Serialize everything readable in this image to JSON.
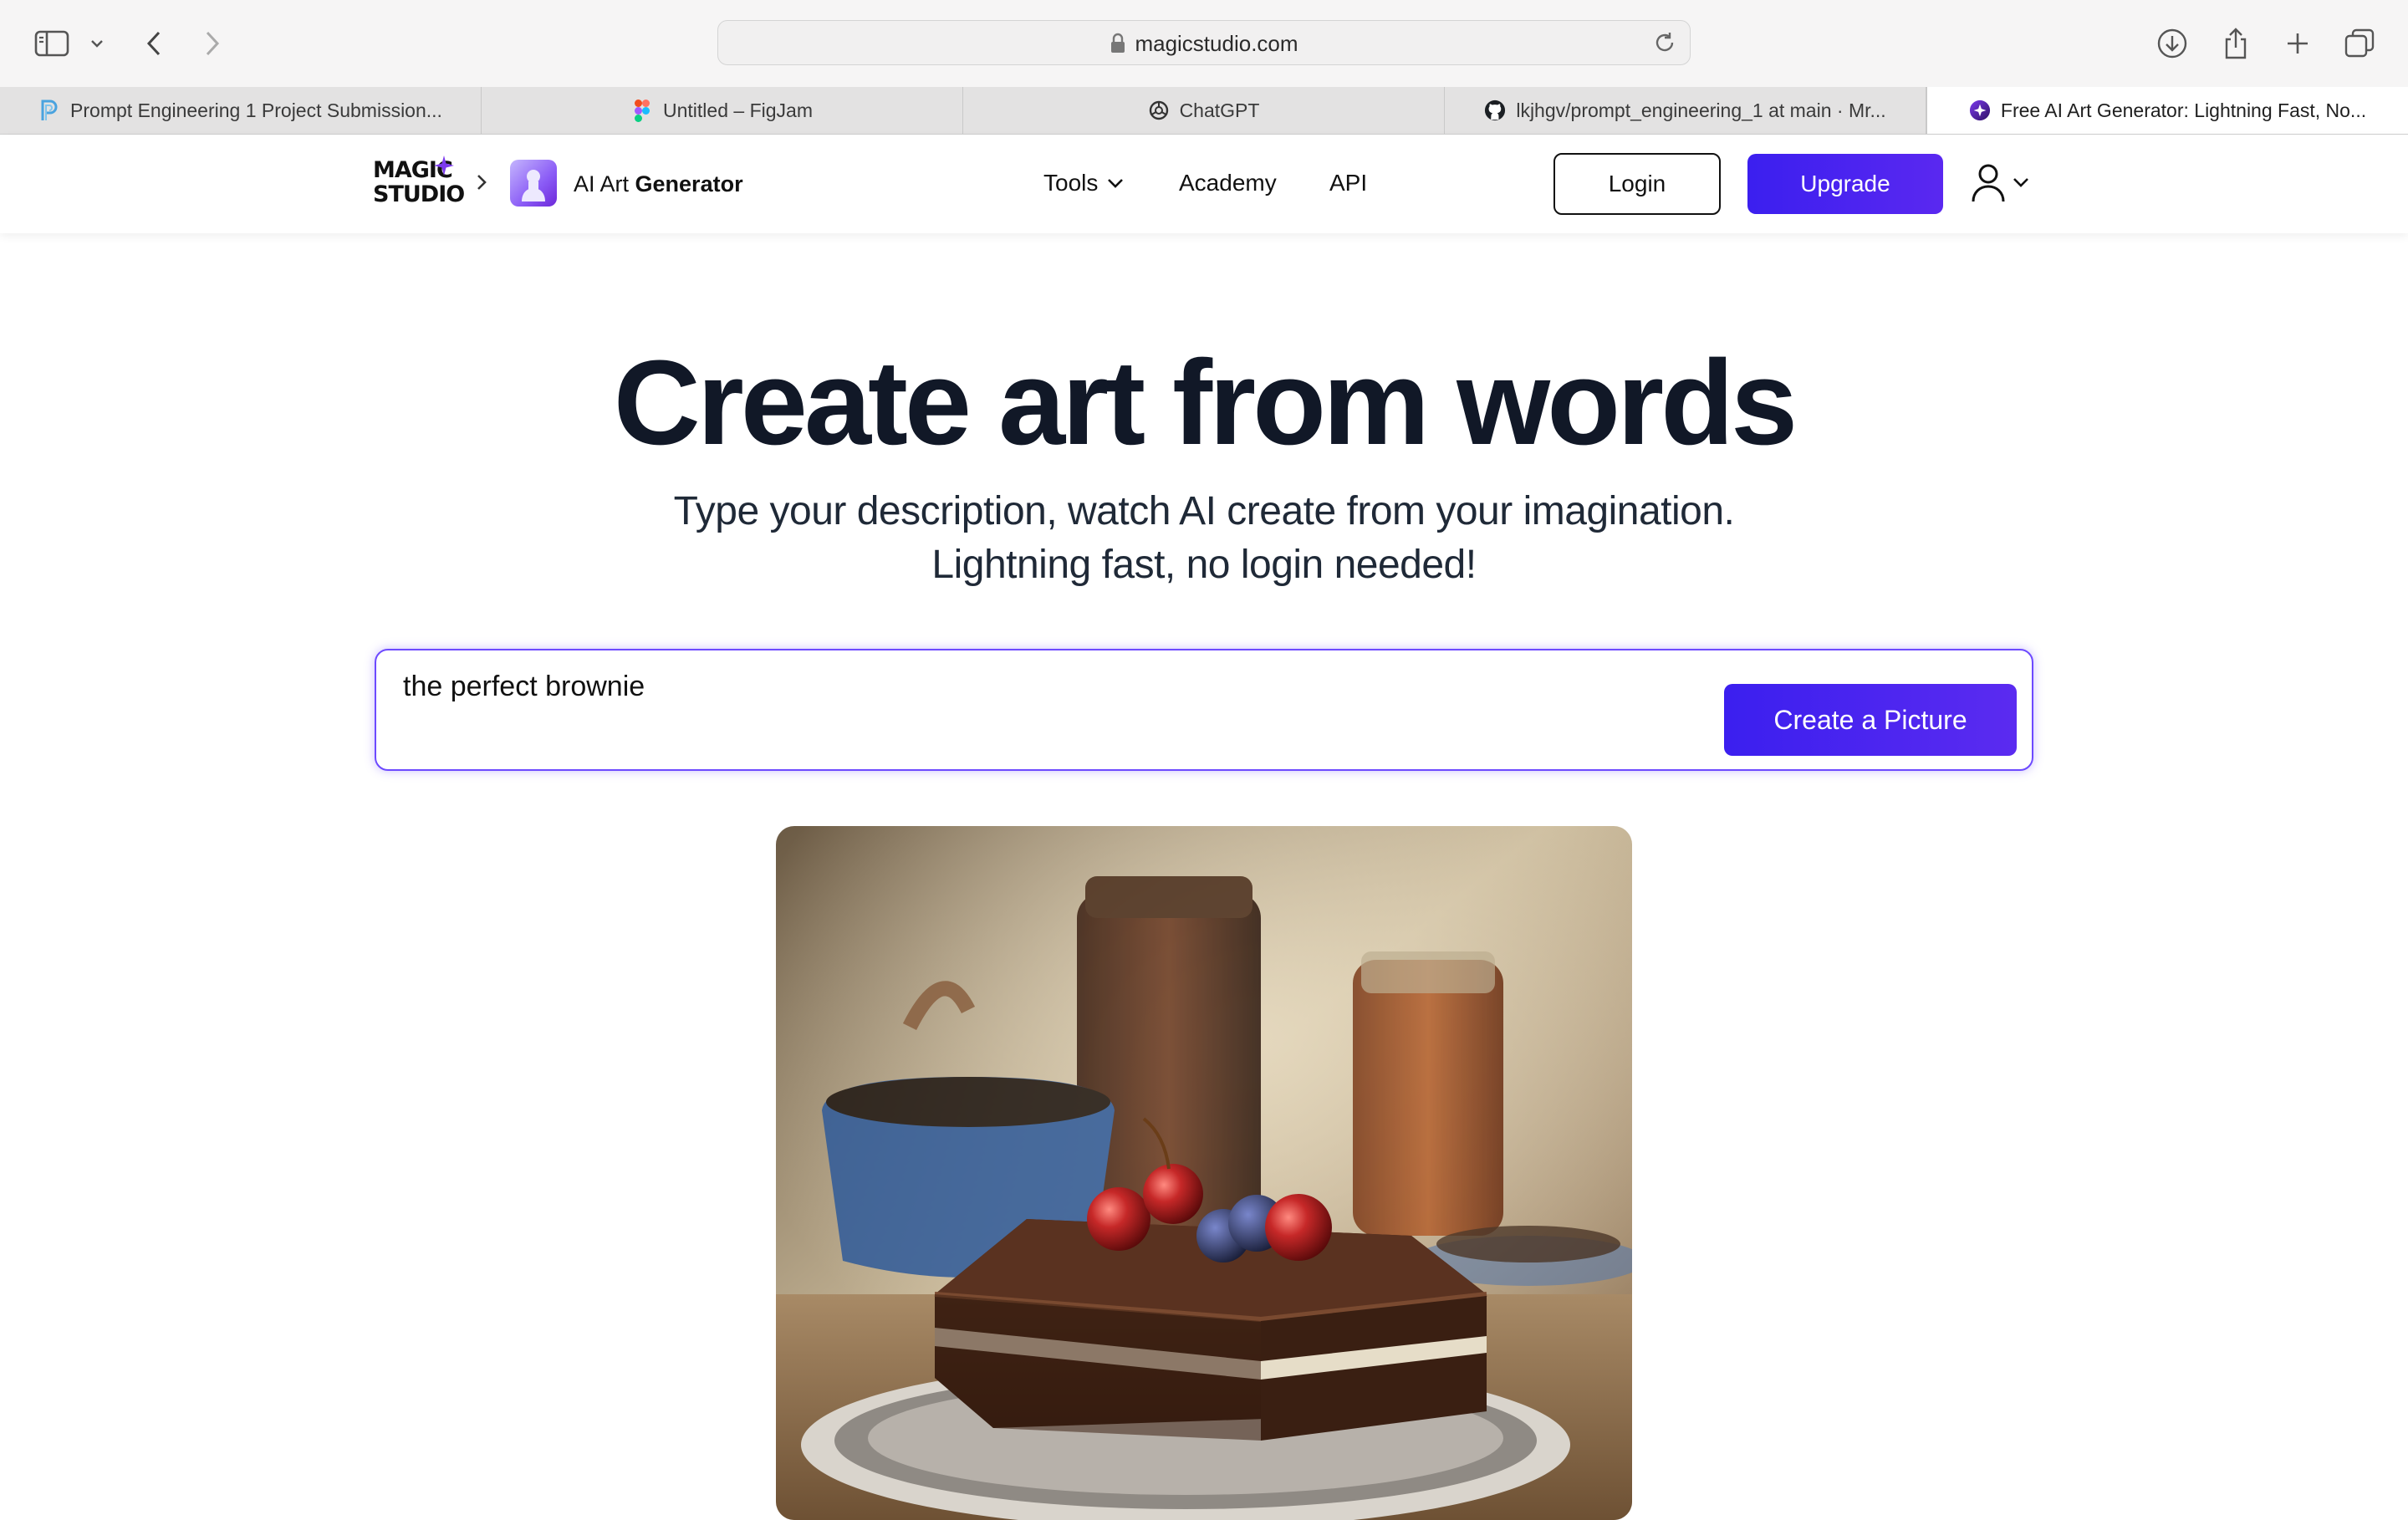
{
  "browser": {
    "url": "magicstudio.com"
  },
  "tabs": [
    {
      "title": "Prompt Engineering 1 Project Submission...",
      "icon": "p-logo-icon"
    },
    {
      "title": "Untitled – FigJam",
      "icon": "figma-icon"
    },
    {
      "title": "ChatGPT",
      "icon": "openai-icon"
    },
    {
      "title": "lkjhgv/prompt_engineering_1 at main · Mr...",
      "icon": "github-icon"
    },
    {
      "title": "Free AI Art Generator: Lightning Fast, No...",
      "icon": "magic-studio-icon",
      "active": true
    }
  ],
  "header": {
    "logo_line1": "MAGIC",
    "logo_line2": "STUDIO",
    "app_name_light": "AI Art ",
    "app_name_bold": "Generator",
    "nav": [
      {
        "label": "Tools"
      },
      {
        "label": "Academy"
      },
      {
        "label": "API"
      }
    ],
    "login_label": "Login",
    "upgrade_label": "Upgrade"
  },
  "hero": {
    "title": "Create art from words",
    "subtitle_line1": "Type your description, watch AI create from your imagination.",
    "subtitle_line2": "Lightning fast, no login needed!"
  },
  "prompt": {
    "value": "the perfect brownie",
    "button_label": "Create a Picture"
  },
  "colors": {
    "accent": "#3b1fef",
    "text": "#111827"
  }
}
